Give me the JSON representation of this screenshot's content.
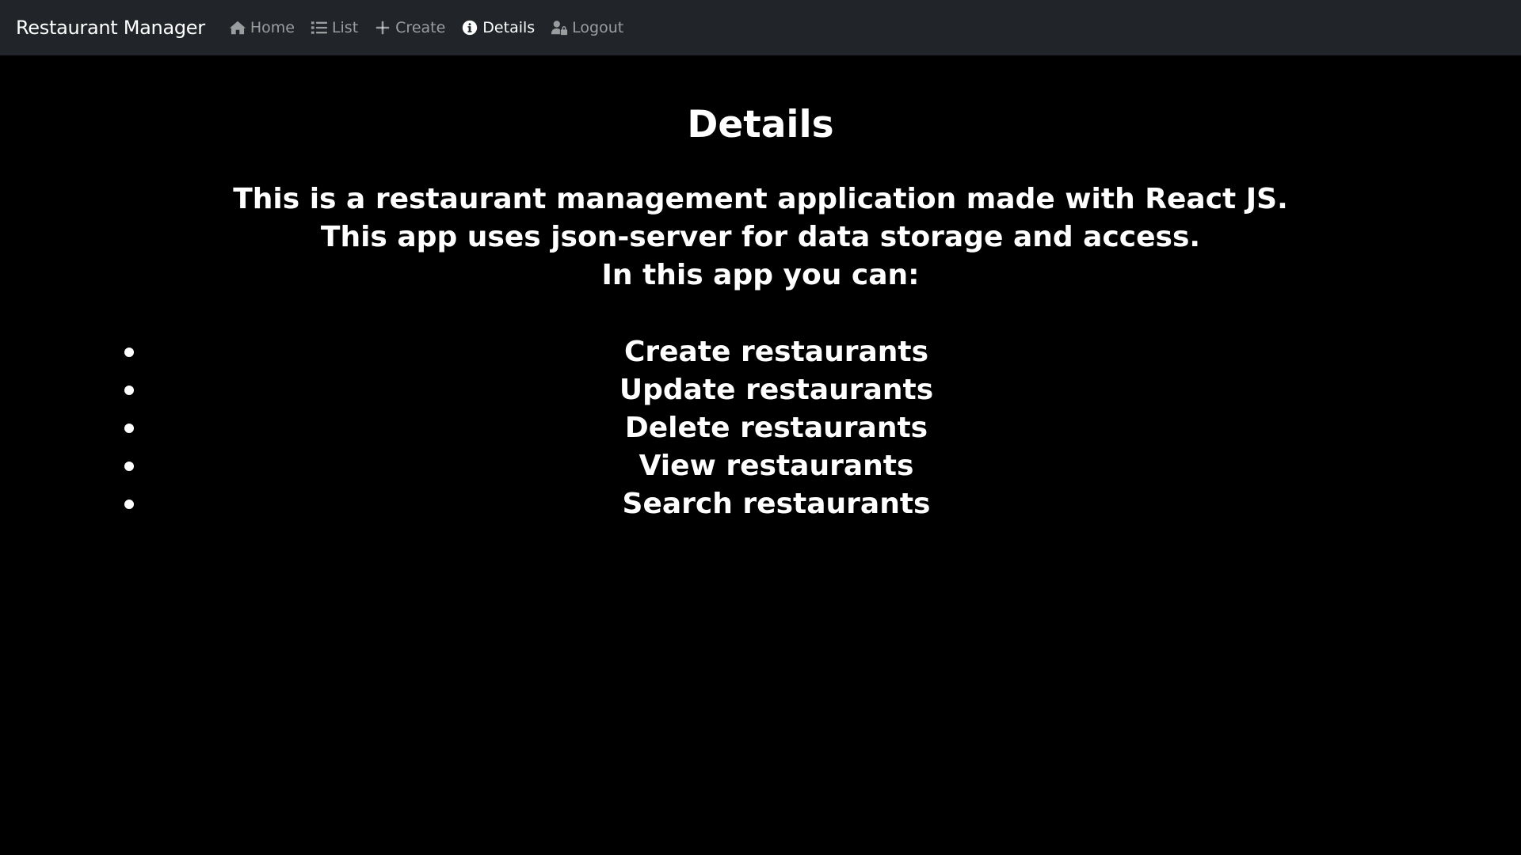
{
  "navbar": {
    "brand": "Restaurant Manager",
    "items": [
      {
        "label": "Home",
        "icon": "home-icon",
        "active": false
      },
      {
        "label": "List",
        "icon": "list-icon",
        "active": false
      },
      {
        "label": "Create",
        "icon": "plus-icon",
        "active": false
      },
      {
        "label": "Details",
        "icon": "info-circle-icon",
        "active": true
      },
      {
        "label": "Logout",
        "icon": "user-lock-icon",
        "active": false
      }
    ]
  },
  "main": {
    "title": "Details",
    "intro": [
      "This is a restaurant management application made with React JS.",
      "This app uses json-server for data storage and access.",
      "In this app you can:"
    ],
    "features": [
      "Create restaurants",
      "Update restaurants",
      "Delete restaurants",
      "View restaurants",
      "Search restaurants"
    ]
  },
  "colors": {
    "navbar_bg": "#212529",
    "page_bg": "#000000",
    "text": "#ffffff",
    "nav_inactive": "#8c8e90"
  }
}
